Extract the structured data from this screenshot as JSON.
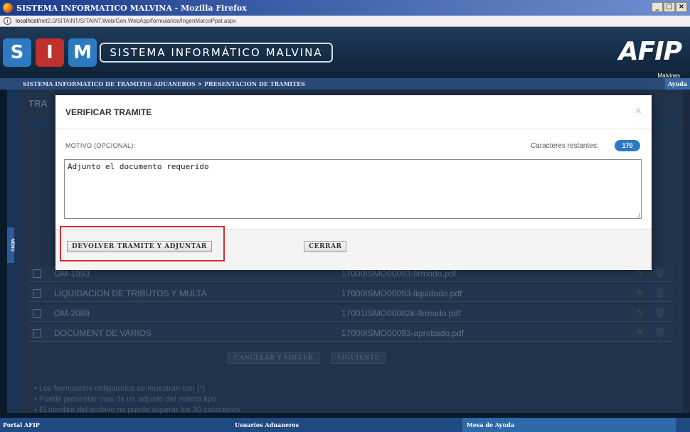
{
  "window": {
    "title": "SISTEMA INFORMATICO MALVINA - Mozilla Firefox",
    "controls": [
      "_",
      "□",
      "×"
    ]
  },
  "urlbar": {
    "host": "localhost",
    "path": "/net2.0/SITAINT/SITAINT.Web/Gen.WebApp/formularios/IngenMarcoPpal.aspx"
  },
  "header": {
    "letters": [
      "S",
      "I",
      "M"
    ],
    "title": "SISTEMA INFORMÁTICO MALVINA",
    "logo": "AFIP",
    "logo_sub": "Malvinas"
  },
  "breadcrumb": {
    "path": "SISTEMA INFORMATICO DE TRAMITES ADUANEROS > PRESENTACION DE TRAMITES",
    "help": "Ayuda"
  },
  "sidebar": {
    "menu_label": "MENU"
  },
  "background": {
    "title": "TRA",
    "files": [
      {
        "name": "OM-1993",
        "file": "17000ISMO00093-firmado.pdf"
      },
      {
        "name": "LIQUIDACION DE TRIBUTOS Y MULTA",
        "file": "17000ISMO00093-liquidado.pdf"
      },
      {
        "name": "OM-2089",
        "file": "17001ISMO00082k-firmado.pdf"
      },
      {
        "name": "DOCUMENT DE VARIOS",
        "file": "17000ISMO00093-aprobado.pdf"
      }
    ],
    "buttons": {
      "cancel": "CANCELAR Y VOLVER",
      "next": "SIGUIENTE"
    },
    "notes": [
      "• Los formularios obligatorios se muestran con (*)",
      "• Puede presentar mas de un adjunto del mismo tipo",
      "• El nombre del archivo no puede superar los 30 caracteres"
    ]
  },
  "footer": {
    "left": "Portal AFIP",
    "middle": "Usuarios Aduaneros",
    "right": "Mesa de Ayuda"
  },
  "modal": {
    "title": "VERIFICAR TRAMITE",
    "close": "×",
    "motivo_label": "MOTIVO (OPCIONAL):",
    "chars_label": "Caracteres restantes:",
    "chars_remaining": "170",
    "motivo_value": "Adjunto el documento requerido",
    "btn_return": "DEVOLVER TRAMITE Y ADJUNTAR",
    "btn_close": "CERRAR"
  },
  "colors": {
    "accent": "#2a7ac8",
    "highlight": "#d03030",
    "header_bg": "#1e3a5a"
  }
}
